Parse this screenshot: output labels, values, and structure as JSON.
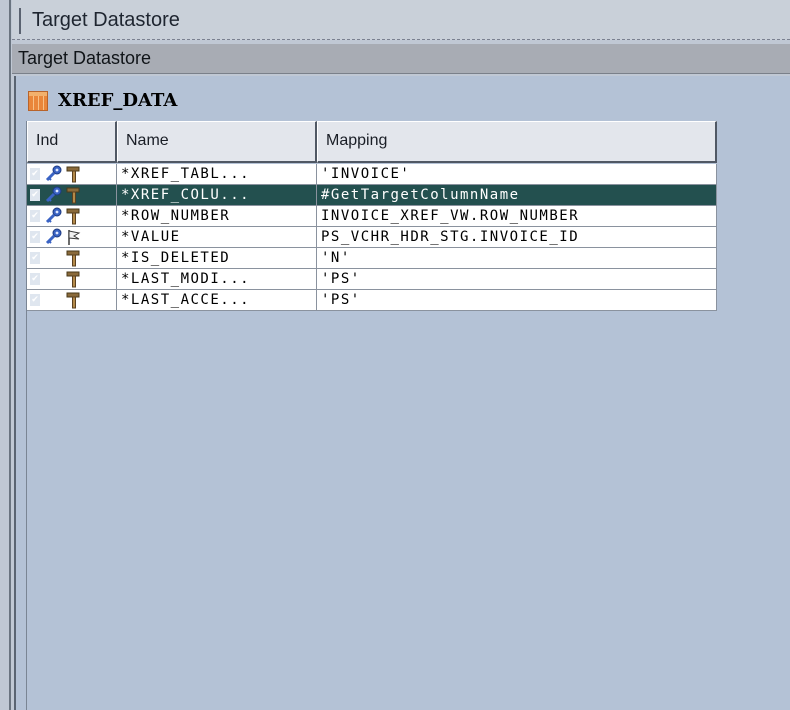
{
  "tab": {
    "title": "Target Datastore"
  },
  "section": {
    "title": "Target Datastore"
  },
  "datastore": {
    "name": "XREF_DATA"
  },
  "table": {
    "columns": [
      "Ind",
      "Name",
      "Mapping"
    ],
    "rows": [
      {
        "name": "*XREF_TABL...",
        "mapping": "'INVOICE'",
        "icons": [
          "key-icon",
          "hammer-icon"
        ],
        "selected": false
      },
      {
        "name": "*XREF_COLU...",
        "mapping": "#GetTargetColumnName",
        "icons": [
          "key-icon",
          "hammer-icon"
        ],
        "selected": true
      },
      {
        "name": "*ROW_NUMBER",
        "mapping": "INVOICE_XREF_VW.ROW_NUMBER",
        "icons": [
          "key-icon",
          "hammer-icon"
        ],
        "selected": false
      },
      {
        "name": "*VALUE",
        "mapping": "PS_VCHR_HDR_STG.INVOICE_ID",
        "icons": [
          "key-icon",
          "flag-icon"
        ],
        "selected": false
      },
      {
        "name": "*IS_DELETED",
        "mapping": "'N'",
        "icons": [
          "hammer-icon"
        ],
        "selected": false
      },
      {
        "name": "*LAST_MODI...",
        "mapping": "'PS'",
        "icons": [
          "hammer-icon"
        ],
        "selected": false
      },
      {
        "name": "*LAST_ACCE...",
        "mapping": "'PS'",
        "icons": [
          "hammer-icon"
        ],
        "selected": false
      }
    ]
  },
  "colors": {
    "selected_row": "#23504f",
    "panel_bg": "#b4c2d6"
  }
}
